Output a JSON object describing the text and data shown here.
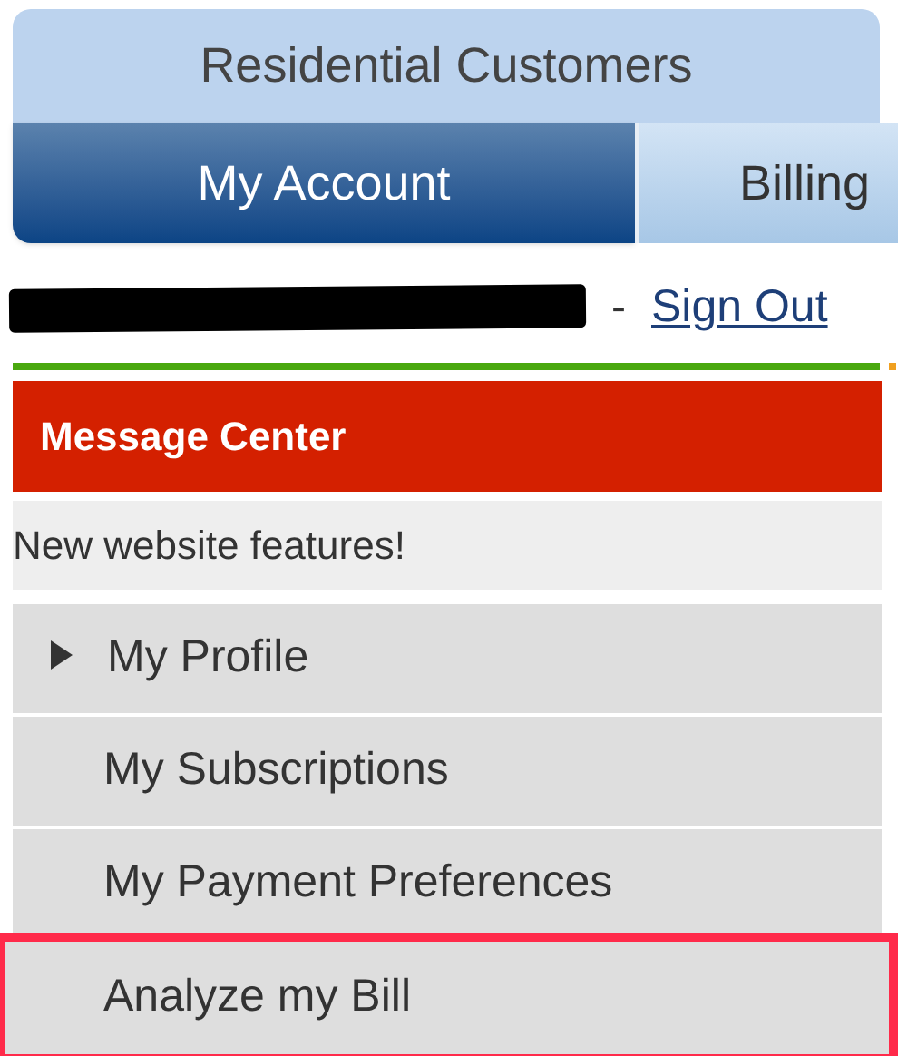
{
  "top_tabs": [
    {
      "label": "Residential Customers",
      "selected": true
    }
  ],
  "sub_tabs": [
    {
      "label": "My Account",
      "selected": true
    },
    {
      "label": "Billing",
      "selected": false
    }
  ],
  "account_line": {
    "separator": "-",
    "sign_out": "Sign Out"
  },
  "message_center": {
    "title": "Message Center",
    "message": "New website features!"
  },
  "menu": [
    {
      "label": "My Profile",
      "expandable": true,
      "highlighted": false
    },
    {
      "label": "My Subscriptions",
      "expandable": false,
      "highlighted": false
    },
    {
      "label": "My Payment Preferences",
      "expandable": false,
      "highlighted": false
    },
    {
      "label": "Analyze my Bill",
      "expandable": false,
      "highlighted": true
    }
  ]
}
